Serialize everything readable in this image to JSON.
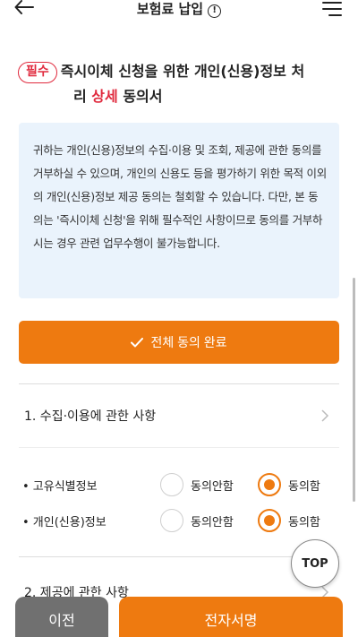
{
  "header": {
    "title": "보험료 납입",
    "info_glyph": "!",
    "back_icon": "arrow-left-icon",
    "menu_icon": "hamburger-menu-icon"
  },
  "title_block": {
    "badge": "필수",
    "line1": "즉시이체 신청을 위한 개인(신용)정보 처",
    "line2_prefix": "리 ",
    "line2_highlight": "상세",
    "line2_suffix": " 동의서"
  },
  "notice": {
    "text": "귀하는 개인(신용)정보의 수집·이용 및 조회, 제공에 관한 동의를 거부하실 수 있으며, 개인의 신용도 등을 평가하기 위한 목적 이외의 개인(신용)정보 제공 동의는 철회할 수 있습니다. 다만, 본 동의는 '즉시이체 신청'을 위해 필수적인 사항이므로 동의를 거부하시는 경우 관련 업무수행이 불가능합니다."
  },
  "agree_all": {
    "label": "전체 동의 완료",
    "icon": "check-icon"
  },
  "sections": [
    {
      "label": "1. 수집·이용에 관한 사항"
    },
    {
      "label": "2. 제공에 관한 사항"
    }
  ],
  "consent_rows": [
    {
      "label": "• 고유식별정보",
      "disagree": "동의안함",
      "agree": "동의함",
      "selected": "agree"
    },
    {
      "label": "• 개인(신용)정보",
      "disagree": "동의안함",
      "agree": "동의함",
      "selected": "agree"
    }
  ],
  "top_button": {
    "label": "TOP"
  },
  "footer": {
    "prev_label": "이전",
    "sign_label": "전자서명"
  },
  "colors": {
    "accent": "#ee7a10",
    "required": "#e02a3e",
    "notice_bg": "#eaf3fc",
    "prev_bg": "#707070"
  }
}
